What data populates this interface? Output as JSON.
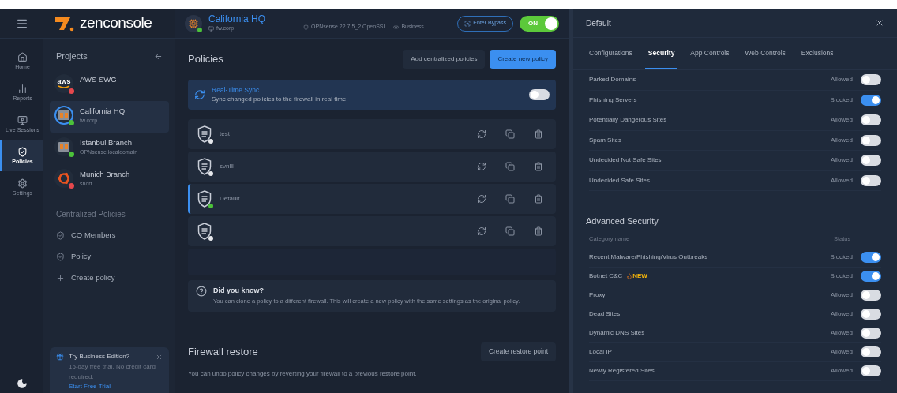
{
  "app": {
    "logo": "zenconsole"
  },
  "rail": [
    {
      "label": "Home",
      "kind": "home",
      "selected": false
    },
    {
      "label": "Reports",
      "kind": "reports",
      "selected": false
    },
    {
      "label": "Live Sessions",
      "kind": "live",
      "selected": false
    },
    {
      "label": "Policies",
      "kind": "policies",
      "selected": true
    },
    {
      "label": "Settings",
      "kind": "settings",
      "selected": false
    }
  ],
  "projects": {
    "title": "Projects",
    "items": [
      {
        "name": "AWS SWG",
        "kind": "aws",
        "logo_text": "aws",
        "color": "#e5484d",
        "selected": false
      },
      {
        "name": "California HQ",
        "subtitle": "fw.corp",
        "kind": "firewall",
        "color": "#4cc23a",
        "selected": true
      },
      {
        "name": "Istanbul Branch",
        "subtitle": "OPNsense.localdomain",
        "kind": "firewall",
        "color": "#4cc23a",
        "selected": false
      },
      {
        "name": "Munich Branch",
        "subtitle": "snort",
        "kind": "ubuntu",
        "color": "#e5484d",
        "selected": false
      }
    ],
    "section_title": "Centralized Policies",
    "links": [
      {
        "label": "CO Members",
        "kind": "policy"
      },
      {
        "label": "Policy",
        "kind": "policy"
      },
      {
        "label": "Create policy",
        "kind": "add"
      }
    ],
    "promo": {
      "title": "Try Business Edition?",
      "text": "15-day free trial. No credit card required.",
      "link": "Start Free Trial"
    }
  },
  "firewall": {
    "name": "California HQ",
    "host": "fw.corp",
    "color": "#4cc23a",
    "version": "OPNsense 22.7.5_2 OpenSSL",
    "edition": "Business",
    "bypass_button": "Enter Bypass",
    "power": {
      "label": "ON",
      "on": true
    }
  },
  "policies": {
    "title": "Policies",
    "buttons": [
      "Add centralized policies",
      "Create new policy"
    ],
    "realtime": {
      "title": "Real-Time Sync",
      "description": "Sync changed policies to the firewall in real time.",
      "on": false
    },
    "list": [
      {
        "name": "test",
        "color": "#e5e7eb",
        "selected": false
      },
      {
        "name": "svnlll",
        "color": "#e5e7eb",
        "selected": false
      },
      {
        "name": "Default",
        "color": "#4cc23a",
        "selected": true
      },
      {
        "color": "#e5e7eb",
        "selected": false
      }
    ]
  },
  "tip": {
    "title": "Did you know?",
    "text": "You can clone a policy to a different firewall. This will create a new policy with the same settings as the original policy."
  },
  "restore": {
    "title": "Firewall restore",
    "button": "Create restore point",
    "text": "You can undo policy changes by reverting your firewall to a previous restore point."
  },
  "drawer": {
    "title": "Default",
    "tabs": [
      {
        "label": "Configurations",
        "selected": false
      },
      {
        "label": "Security",
        "selected": true
      },
      {
        "label": "App Controls",
        "selected": false
      },
      {
        "label": "Web Controls",
        "selected": false
      },
      {
        "label": "Exclusions",
        "selected": false
      }
    ],
    "rows": [
      {
        "name": "Parked Domains",
        "status": "Allowed",
        "on": false
      },
      {
        "name": "Phishing Servers",
        "status": "Blocked",
        "on": true
      },
      {
        "name": "Potentially Dangerous Sites",
        "status": "Allowed",
        "on": false
      },
      {
        "name": "Spam Sites",
        "status": "Allowed",
        "on": false
      },
      {
        "name": "Undecided Not Safe Sites",
        "status": "Allowed",
        "on": false
      },
      {
        "name": "Undecided Safe Sites",
        "status": "Allowed",
        "on": false
      }
    ],
    "advanced": {
      "title": "Advanced Security",
      "columns": [
        "Category name",
        "Status"
      ],
      "rows": [
        {
          "name": "Recent Malware/Phishing/Virus Outbreaks",
          "status": "Blocked",
          "on": true
        },
        {
          "name": "Botnet C&C",
          "badge": "NEW",
          "status": "Blocked",
          "on": true
        },
        {
          "name": "Proxy",
          "status": "Allowed",
          "on": false
        },
        {
          "name": "Dead Sites",
          "status": "Allowed",
          "on": false
        },
        {
          "name": "Dynamic DNS Sites",
          "status": "Allowed",
          "on": false
        },
        {
          "name": "Local IP",
          "status": "Allowed",
          "on": false
        },
        {
          "name": "Newly Registered Sites",
          "status": "Allowed",
          "on": false
        }
      ]
    }
  }
}
